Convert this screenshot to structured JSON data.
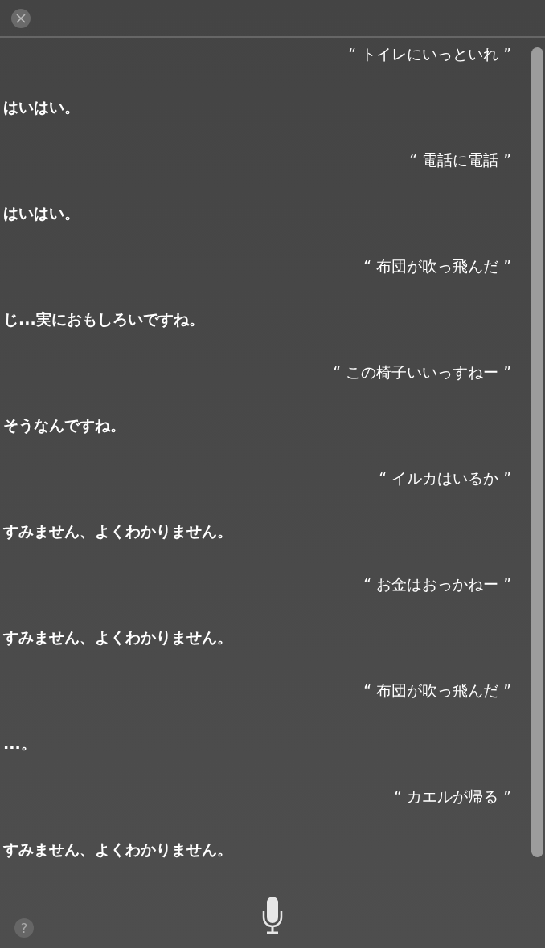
{
  "messages": [
    {
      "kind": "user",
      "text": "“ トイレにいっといれ ”"
    },
    {
      "kind": "assistant",
      "text": "はいはい。"
    },
    {
      "kind": "user",
      "text": "“ 電話に電話 ”"
    },
    {
      "kind": "assistant",
      "text": "はいはい。"
    },
    {
      "kind": "user",
      "text": "“ 布団が吹っ飛んだ ”"
    },
    {
      "kind": "assistant",
      "text": "じ...実におもしろいですね。"
    },
    {
      "kind": "user",
      "text": "“ この椅子いいっすねー ”"
    },
    {
      "kind": "assistant",
      "text": "そうなんですね。"
    },
    {
      "kind": "user",
      "text": "“ イルカはいるか ”"
    },
    {
      "kind": "assistant",
      "text": "すみません、よくわかりません。"
    },
    {
      "kind": "user",
      "text": "“ お金はおっかねー ”"
    },
    {
      "kind": "assistant",
      "text": "すみません、よくわかりません。"
    },
    {
      "kind": "user",
      "text": "“ 布団が吹っ飛んだ ”"
    },
    {
      "kind": "assistant",
      "text": "...。"
    },
    {
      "kind": "user",
      "text": "“ カエルが帰る ”"
    },
    {
      "kind": "assistant",
      "text": "すみません、よくわかりません。"
    }
  ],
  "footer": {
    "help_button": "?"
  }
}
